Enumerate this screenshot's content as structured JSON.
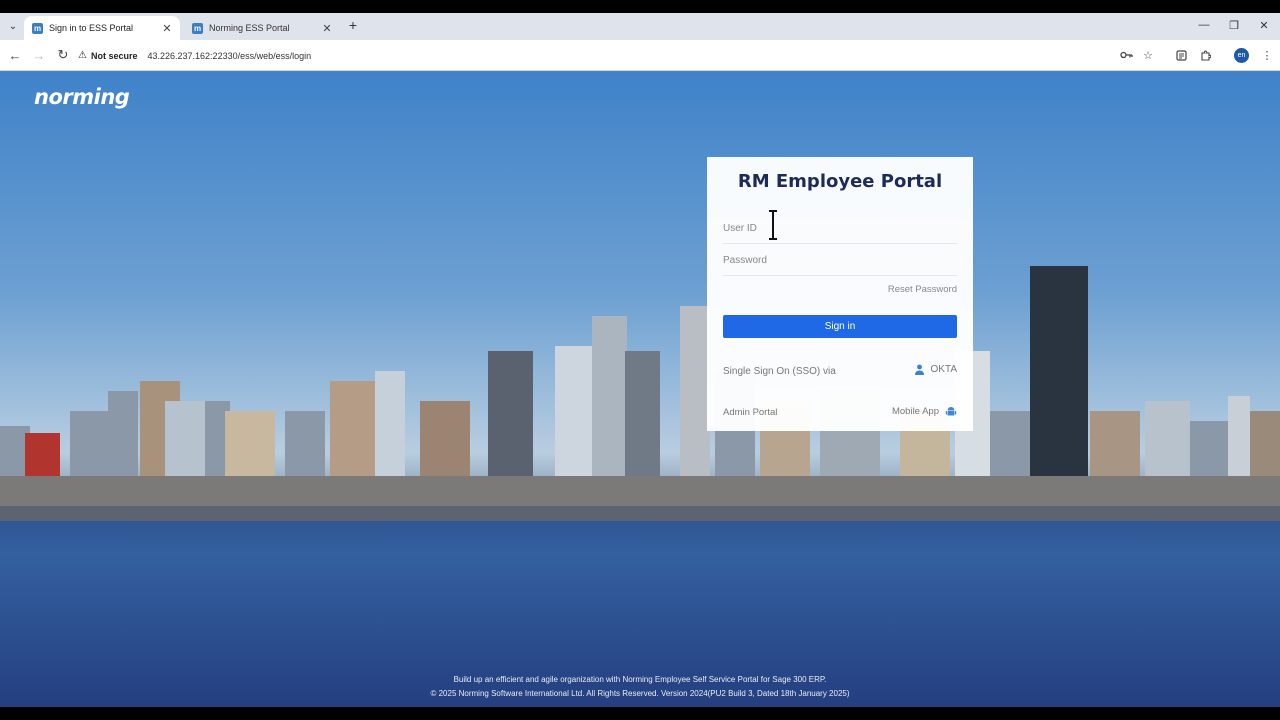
{
  "browser": {
    "tabs": [
      {
        "title": "Sign in to ESS Portal",
        "favicon": "m"
      },
      {
        "title": "Norming ESS Portal",
        "favicon": "m"
      }
    ],
    "address": {
      "security_label": "Not secure",
      "url": "43.226.237.162:22330/ess/web/ess/login"
    },
    "profile_initials": "en"
  },
  "page": {
    "brand": "norming",
    "login": {
      "title": "RM Employee Portal",
      "userid_placeholder": "User ID",
      "password_placeholder": "Password",
      "reset_password": "Reset Password",
      "signin_label": "Sign in",
      "sso_label": "Single Sign On (SSO) via",
      "okta_label": "OKTA",
      "admin_portal": "Admin Portal",
      "mobile_app": "Mobile App"
    },
    "footer": {
      "line1": "Build up an efficient and agile organization with Norming Employee Self Service Portal for Sage 300 ERP.",
      "line2": "© 2025 Norming Software International Ltd. All Rights Reserved. Version 2024(PU2 Build 3, Dated 18th January 2025)"
    }
  },
  "colors": {
    "accent": "#1f69e6",
    "title": "#1d2b5a"
  }
}
